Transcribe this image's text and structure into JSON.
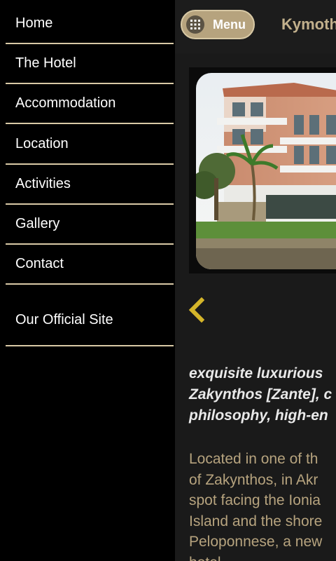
{
  "nav": {
    "items": [
      {
        "label": "Home"
      },
      {
        "label": "The Hotel"
      },
      {
        "label": "Accommodation"
      },
      {
        "label": "Location"
      },
      {
        "label": "Activities"
      },
      {
        "label": "Gallery"
      },
      {
        "label": "Contact"
      }
    ],
    "official_site": "Our Official Site"
  },
  "header": {
    "menu_label": "Menu",
    "menu_icon": "grid-icon",
    "title": "Kymothoi"
  },
  "slider": {
    "prev_icon": "chevron-left-icon"
  },
  "content": {
    "intro_lines": [
      "exquisite luxurious",
      "Zakynthos [Zante], c",
      "philosophy, high-en"
    ],
    "body_lines": [
      "Located in one of th",
      "of Zakynthos, in Akr",
      "spot facing the Ionia",
      "Island and the shore",
      "Peloponnese, a new",
      "hotel ..."
    ]
  },
  "colors": {
    "accent": "#b6a37e",
    "accent_light": "#d9c9a6",
    "chevron": "#d4b52a"
  }
}
